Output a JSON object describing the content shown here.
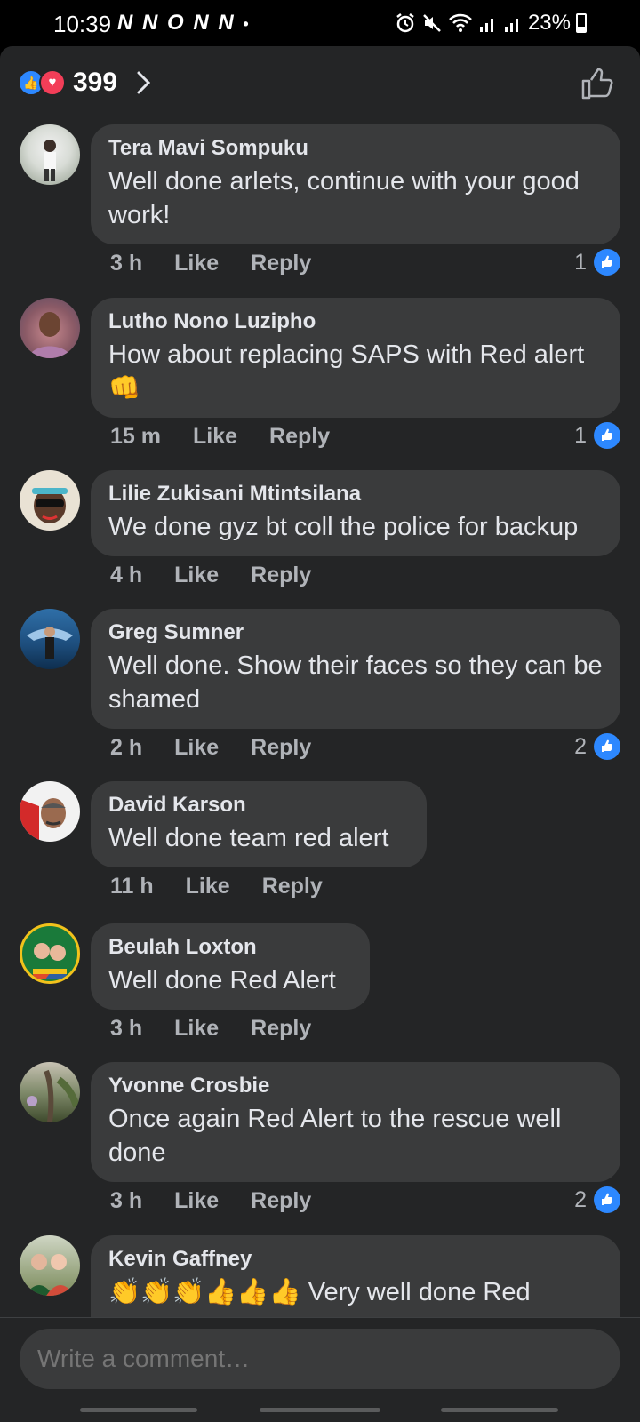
{
  "status_bar": {
    "time": "10:39",
    "carriers": "N N O N N",
    "dot": "•",
    "battery": "23%",
    "icons": [
      "alarm-icon",
      "mute-icon",
      "wifi-icon",
      "signal-icon",
      "signal-icon",
      "battery-icon"
    ]
  },
  "reactions": {
    "count": "399",
    "types": [
      "like",
      "love"
    ]
  },
  "comments": [
    {
      "author": "Tera Mavi Sompuku",
      "text": "Well done arlets, continue with your good work!",
      "time": "3 h",
      "like_label": "Like",
      "reply_label": "Reply",
      "likes": "1"
    },
    {
      "author": "Lutho Nono Luzipho",
      "text": "How about replacing SAPS with Red alert👊",
      "time": "15 m",
      "like_label": "Like",
      "reply_label": "Reply",
      "likes": "1"
    },
    {
      "author": "Lilie Zukisani Mtintsilana",
      "text": "We done gyz bt coll the police for backup",
      "time": "4 h",
      "like_label": "Like",
      "reply_label": "Reply",
      "likes": ""
    },
    {
      "author": "Greg Sumner",
      "text": "Well done. Show their faces so they can be shamed",
      "time": "2 h",
      "like_label": "Like",
      "reply_label": "Reply",
      "likes": "2"
    },
    {
      "author": "David Karson",
      "text": "Well done team red alert",
      "time": "11 h",
      "like_label": "Like",
      "reply_label": "Reply",
      "likes": ""
    },
    {
      "author": "Beulah Loxton",
      "text": "Well done Red Alert",
      "time": "3 h",
      "like_label": "Like",
      "reply_label": "Reply",
      "likes": ""
    },
    {
      "author": "Yvonne Crosbie",
      "text": "Once again Red Alert to the rescue well done",
      "time": "3 h",
      "like_label": "Like",
      "reply_label": "Reply",
      "likes": "2"
    },
    {
      "author": "Kevin Gaffney",
      "text": "👏👏👏👍👍👍 Very well done Red",
      "time": "",
      "like_label": "",
      "reply_label": "",
      "likes": ""
    }
  ],
  "composer": {
    "placeholder": "Write a comment…"
  },
  "colors": {
    "sheet_bg": "#242526",
    "bubble_bg": "#3a3b3c",
    "text_primary": "#e4e6eb",
    "text_secondary": "#b0b3b8",
    "like_blue": "#2d88ff",
    "love_red": "#f33e58"
  }
}
